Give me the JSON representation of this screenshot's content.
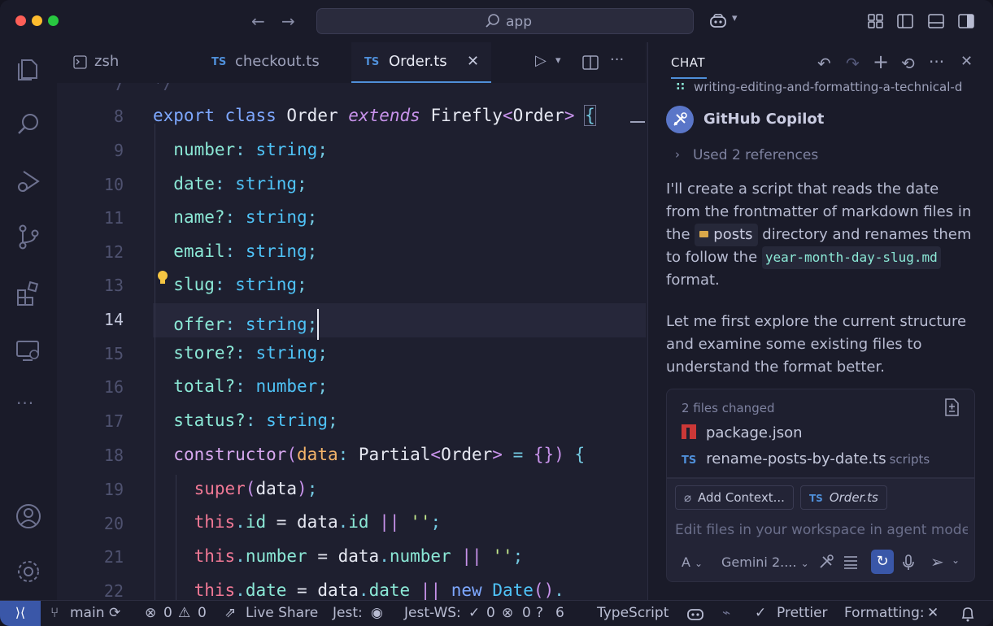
{
  "titlebar": {
    "search_text": "app",
    "back_icon": "←",
    "forward_icon": "→"
  },
  "tabs": [
    {
      "label": "zsh",
      "icon": "terminal-icon"
    },
    {
      "label": "checkout.ts",
      "badge": "TS"
    },
    {
      "label": "Order.ts",
      "badge": "TS",
      "close": "✕"
    }
  ],
  "editor": {
    "partial_line": "*/",
    "line_numbers": [
      "7",
      "8",
      "9",
      "10",
      "11",
      "12",
      "13",
      "14",
      "15",
      "16",
      "17",
      "18",
      "19",
      "20",
      "21",
      "22"
    ],
    "current_line": "14",
    "accent": "#4f8fd9"
  },
  "chat": {
    "title": "CHAT",
    "ref_file": "writing-editing-and-formatting-a-technical-d",
    "assistant_name": "GitHub Copilot",
    "used_refs": "Used 2 references",
    "para1_a": "I'll create a script that reads the date from the frontmatter of markdown files in the",
    "para1_chip": "posts",
    "para1_b": "directory and renames them to follow the",
    "para1_code": "year-month-day-slug.md",
    "para1_c": "format.",
    "para2": "Let me first explore the current structure and examine some existing files to understand the format better.",
    "changes_header": "2 files changed",
    "files": [
      {
        "name": "package.json",
        "dir": ""
      },
      {
        "name": "rename-posts-by-date.ts",
        "dir": "scripts"
      }
    ],
    "add_context": "Add Context...",
    "context_file": "Order.ts",
    "input_placeholder": "Edit files in your workspace in agent mode",
    "mode": "A",
    "model": "Gemini 2...."
  },
  "status": {
    "branch": "main",
    "errors": "0",
    "warnings": "0",
    "live_share": "Live Share",
    "jest": "Jest:",
    "jest_ws": "Jest-WS:",
    "jest_ws_pass": "0",
    "jest_ws_fail": "0",
    "jest_ws_unknown": "6",
    "language": "TypeScript",
    "prettier": "Prettier",
    "formatting": "Formatting:",
    "formatting_state": "✕"
  }
}
